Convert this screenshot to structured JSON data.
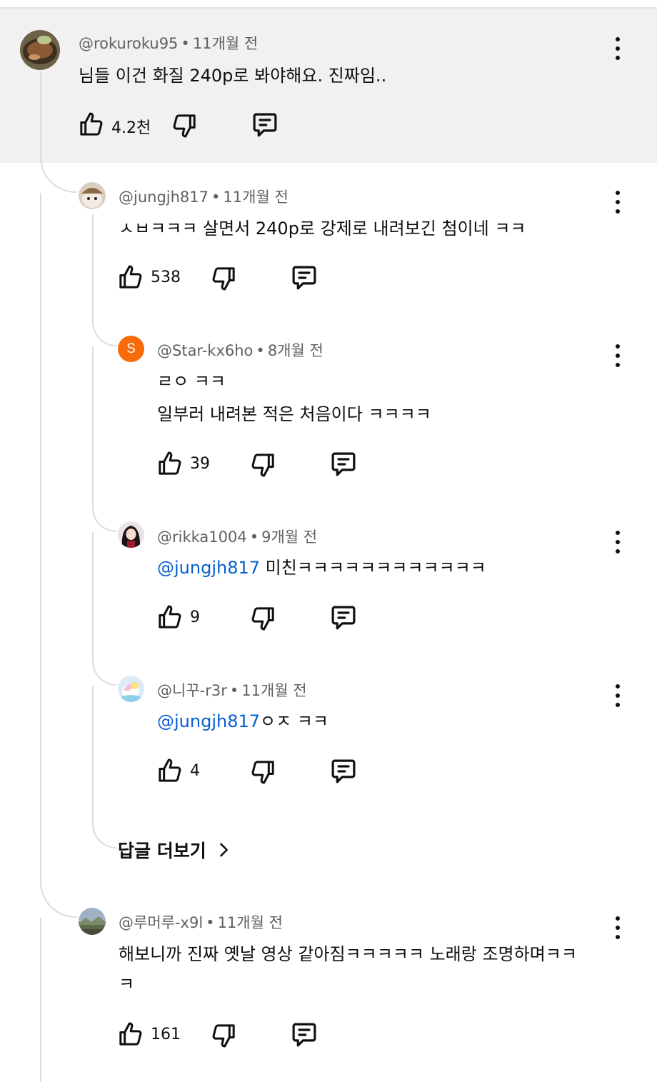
{
  "comments": [
    {
      "handle": "@rokuroku95",
      "time": "11개월 전",
      "lines": [
        "님들 이건 화질 240p로 봐야해요. 진짜임.."
      ],
      "likes": "4.2천"
    },
    {
      "handle": "@jungjh817",
      "time": "11개월 전",
      "lines": [
        "ㅅㅂㅋㅋㅋ 살면서 240p로 강제로 내려보긴 첨이네 ㅋㅋ"
      ],
      "likes": "538"
    },
    {
      "handle": "@Star-kx6ho",
      "time": "8개월 전",
      "avatar_letter": "S",
      "avatar_color": "#f76b0a",
      "lines": [
        "ㄹㅇ ㅋㅋ",
        "일부러 내려본 적은 처음이다 ㅋㅋㅋㅋ"
      ],
      "likes": "39"
    },
    {
      "handle": "@rikka1004",
      "time": "9개월 전",
      "mention": "@jungjh817",
      "text": " 미친ㅋㅋㅋㅋㅋㅋㅋㅋㅋㅋㅋㅋ",
      "likes": "9"
    },
    {
      "handle": "@니꾸-r3r",
      "time": "11개월 전",
      "mention": "@jungjh817",
      "text": "ㅇㅈ ㅋㅋ",
      "likes": "4"
    },
    {
      "handle": "@루머루-x9l",
      "time": "11개월 전",
      "lines": [
        "해보니까 진짜 옛날 영상 같아짐ㅋㅋㅋㅋㅋ 노래랑 조명하며ㅋㅋ",
        "ㅋ"
      ],
      "likes": "161"
    }
  ],
  "more_replies_label": "답글 더보기",
  "dot_separator": "•",
  "icons": {
    "like": "thumbs-up-icon",
    "dislike": "thumbs-down-icon",
    "reply": "reply-comment-icon",
    "more": "more-vertical-icon",
    "chevron": "chevron-right-icon"
  },
  "colors": {
    "highlight_bg": "#f1f1f1",
    "mention": "#065fd4",
    "meta_text": "#606060",
    "thread_line": "#dcdcdc"
  }
}
